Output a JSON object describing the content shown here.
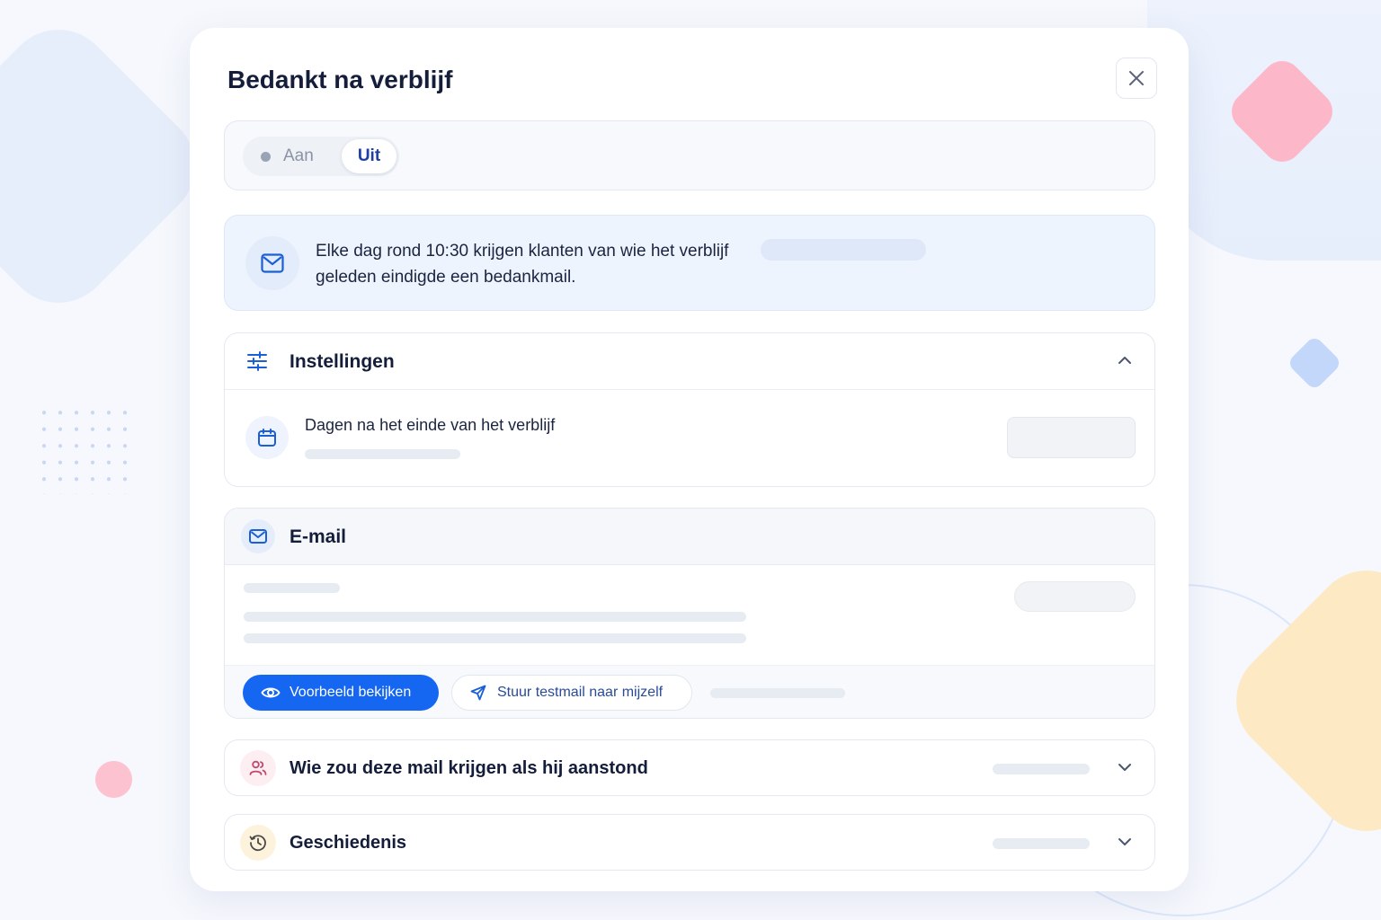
{
  "modal": {
    "title": "Bedankt na verblijf"
  },
  "toggle": {
    "on_label": "Aan",
    "off_label": "Uit",
    "selected": "Uit"
  },
  "info": {
    "text": "Elke dag rond 10:30 krijgen klanten van wie het verblijf geleden eindigde een bedankmail."
  },
  "settings": {
    "title": "Instellingen",
    "item_label": "Dagen na het einde van het verblijf"
  },
  "email": {
    "title": "E-mail",
    "preview_button": "Voorbeeld bekijken",
    "test_button": "Stuur testmail naar mijzelf"
  },
  "recipients": {
    "title": "Wie zou deze mail krijgen als hij aanstond"
  },
  "history": {
    "title": "Geschiedenis"
  },
  "colors": {
    "accent": "#1566f0",
    "toggle_selected_text": "#1f3fa6",
    "info_background": "#eef4fe"
  }
}
